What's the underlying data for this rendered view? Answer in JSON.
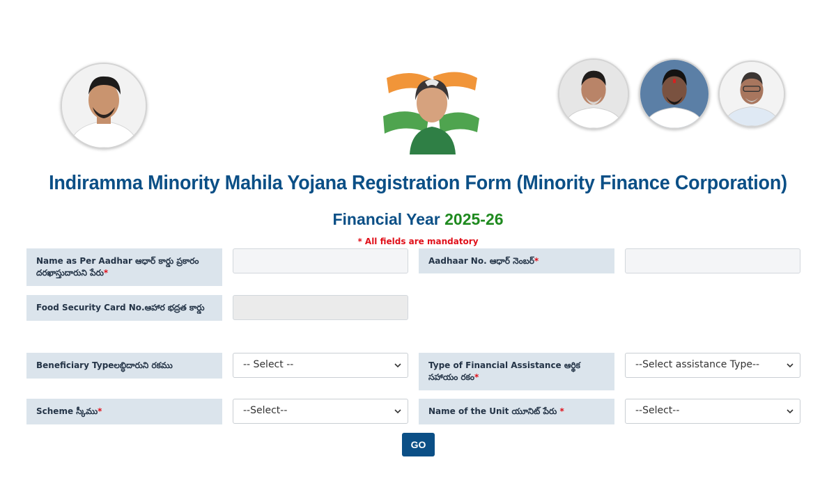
{
  "header": {
    "title": "Indiramma Minority Mahila Yojana Registration Form (Minority Finance Corporation)",
    "financial_year_label": "Financial Year",
    "financial_year_value": "2025-26",
    "mandatory_note": "* All fields are mandatory"
  },
  "form": {
    "name_label": "Name as Per Aadhar ఆధార్ కార్డు ప్రకారం దరఖాస్తుదారుని పేరు",
    "aadhaar_label": "Aadhaar No. ఆధార్ నెంబర్",
    "food_card_label": "Food Security Card No.ఆహార భద్రత కార్డు",
    "beneficiary_label": "Beneficiary Typeలబ్ధిదారుని రకము",
    "beneficiary_value": "-- Select --",
    "assistance_label": "Type of Financial Assistance ఆర్థిక సహాయం రకం",
    "assistance_value": "--Select assistance Type--",
    "scheme_label": "Scheme స్కీము",
    "scheme_value": "--Select--",
    "unit_label": "Name of the Unit యూనిట్ పేరు ",
    "unit_value": "--Select--",
    "required_mark": "*",
    "go_label": "GO"
  },
  "colors": {
    "primary": "#0b4f86",
    "accent_green": "#1f8a1f",
    "required_red": "#e0101a",
    "label_bg": "#dbe4ec"
  }
}
